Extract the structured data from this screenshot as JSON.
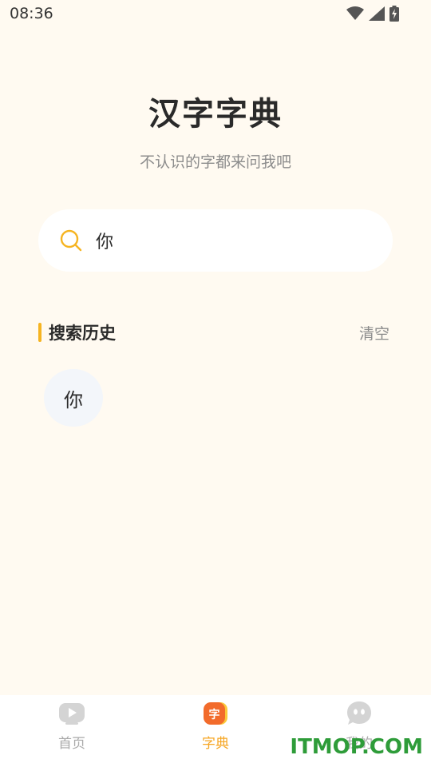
{
  "status_bar": {
    "time": "08:36"
  },
  "header": {
    "title": "汉字字典",
    "subtitle": "不认识的字都来问我吧"
  },
  "search": {
    "value": "你"
  },
  "history": {
    "title": "搜索历史",
    "clear_label": "清空",
    "items": [
      {
        "label": "你"
      }
    ]
  },
  "nav": {
    "items": [
      {
        "label": "首页",
        "icon": "play-icon",
        "active": false
      },
      {
        "label": "字典",
        "icon": "dictionary-icon",
        "active": true,
        "badge": "字"
      },
      {
        "label": "我的",
        "icon": "profile-icon",
        "active": false
      }
    ]
  },
  "watermark": "ITMOP.COM",
  "colors": {
    "accent": "#f6b421",
    "active_nav": "#f6a623",
    "background": "#fffaf1"
  }
}
